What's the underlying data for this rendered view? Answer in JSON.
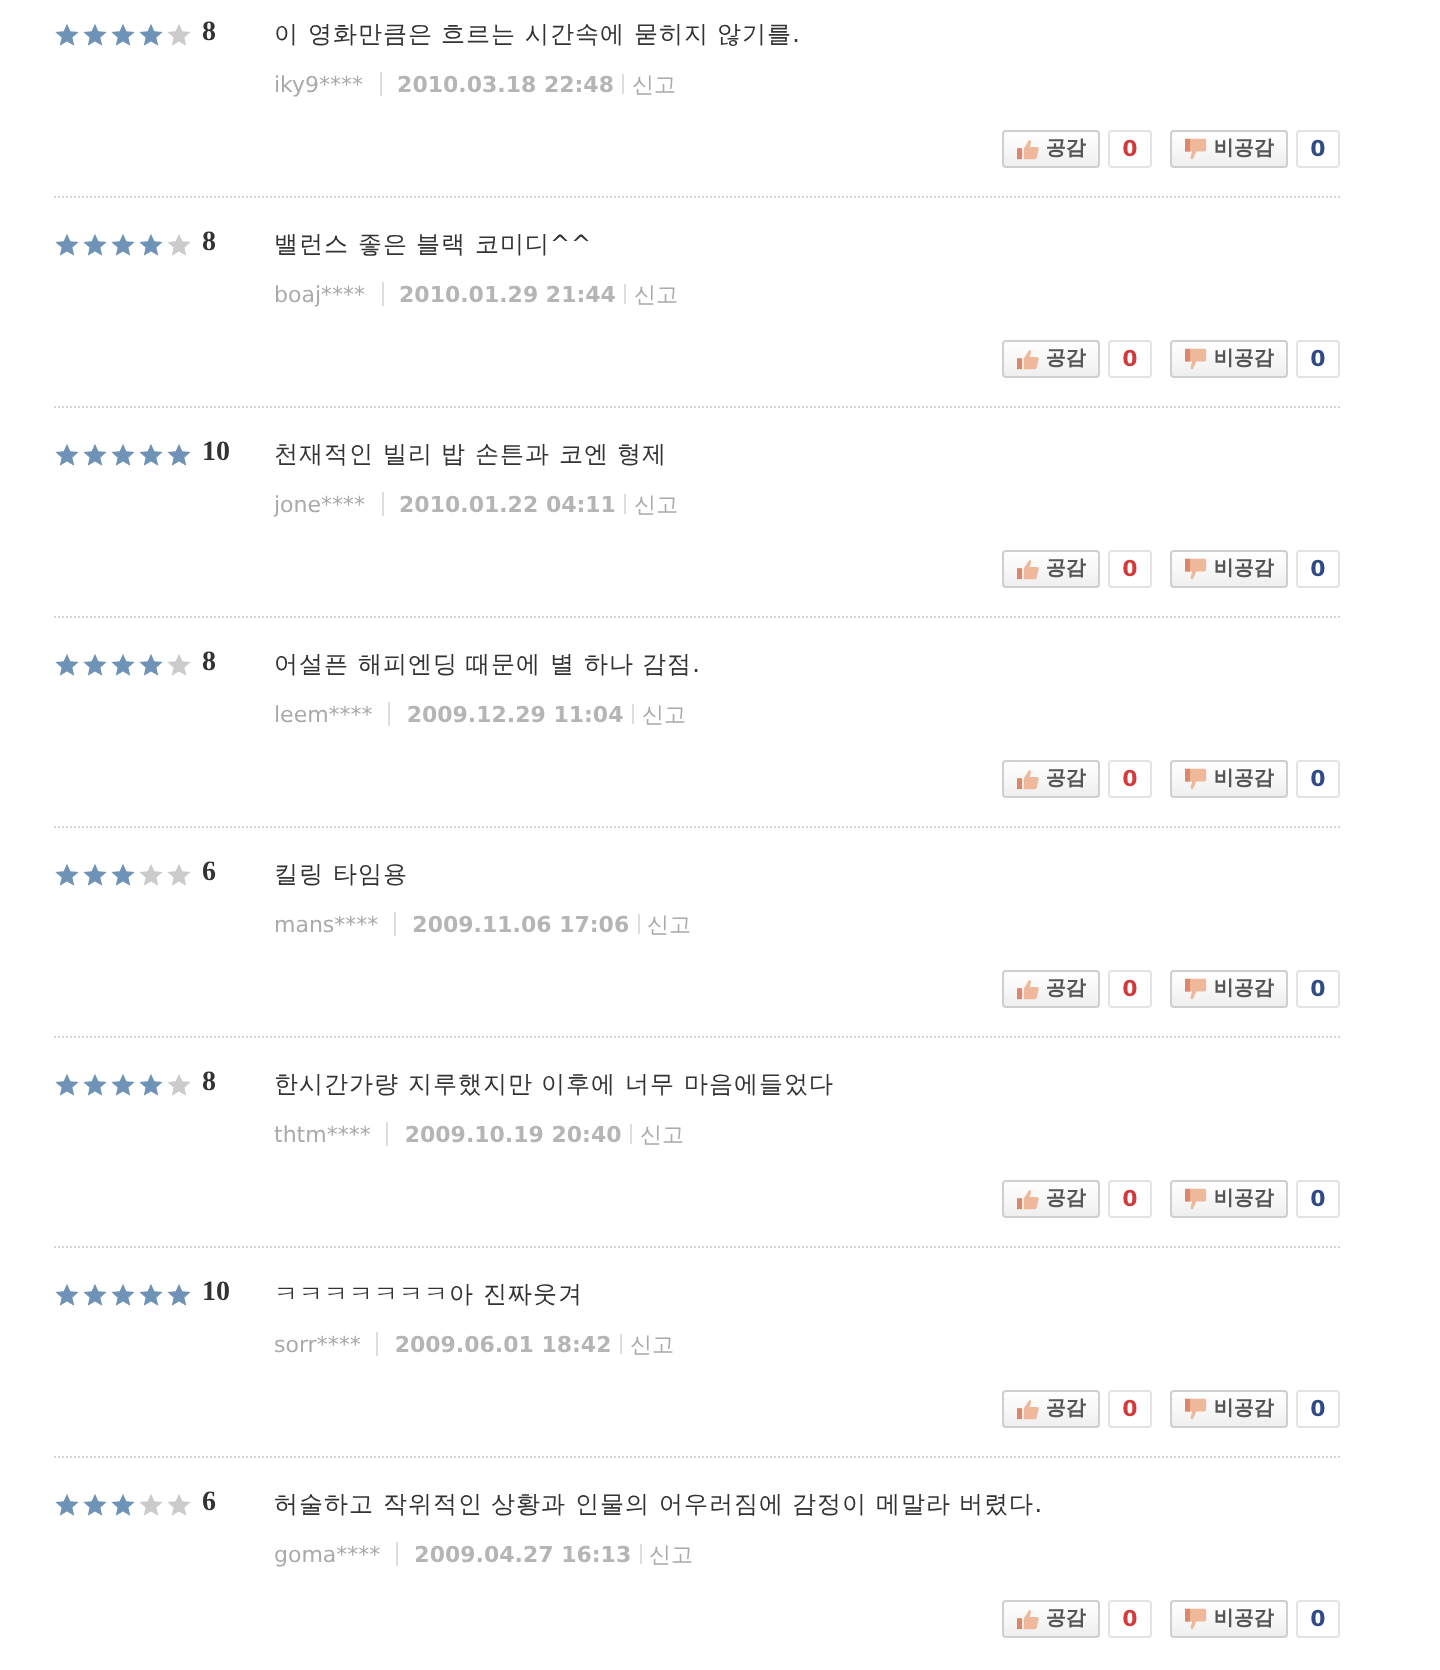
{
  "reviews": [
    {
      "stars": 4,
      "score": "8",
      "comment": "이 영화만큼은 흐르는 시간속에 묻히지 않기를.",
      "user": "iky9****",
      "date": "2010.03.18 22:48",
      "report": "신고",
      "like": {
        "label": "공감",
        "count": "0"
      },
      "dislike": {
        "label": "비공감",
        "count": "0"
      }
    },
    {
      "stars": 4,
      "score": "8",
      "comment": "밸런스 좋은 블랙 코미디^^",
      "user": "boaj****",
      "date": "2010.01.29 21:44",
      "report": "신고",
      "like": {
        "label": "공감",
        "count": "0"
      },
      "dislike": {
        "label": "비공감",
        "count": "0"
      }
    },
    {
      "stars": 5,
      "score": "10",
      "comment": "천재적인 빌리 밥 손튼과 코엔 형제",
      "user": "jone****",
      "date": "2010.01.22 04:11",
      "report": "신고",
      "like": {
        "label": "공감",
        "count": "0"
      },
      "dislike": {
        "label": "비공감",
        "count": "0"
      }
    },
    {
      "stars": 4,
      "score": "8",
      "comment": "어설픈 해피엔딩 때문에 별 하나 감점.",
      "user": "leem****",
      "date": "2009.12.29 11:04",
      "report": "신고",
      "like": {
        "label": "공감",
        "count": "0"
      },
      "dislike": {
        "label": "비공감",
        "count": "0"
      }
    },
    {
      "stars": 3,
      "score": "6",
      "comment": "킬링 타임용",
      "user": "mans****",
      "date": "2009.11.06 17:06",
      "report": "신고",
      "like": {
        "label": "공감",
        "count": "0"
      },
      "dislike": {
        "label": "비공감",
        "count": "0"
      }
    },
    {
      "stars": 4,
      "score": "8",
      "comment": "한시간가량 지루했지만 이후에 너무 마음에들었다",
      "user": "thtm****",
      "date": "2009.10.19 20:40",
      "report": "신고",
      "like": {
        "label": "공감",
        "count": "0"
      },
      "dislike": {
        "label": "비공감",
        "count": "0"
      }
    },
    {
      "stars": 5,
      "score": "10",
      "comment": "ㅋㅋㅋㅋㅋㅋㅋ아 진짜웃겨",
      "user": "sorr****",
      "date": "2009.06.01 18:42",
      "report": "신고",
      "like": {
        "label": "공감",
        "count": "0"
      },
      "dislike": {
        "label": "비공감",
        "count": "0"
      }
    },
    {
      "stars": 3,
      "score": "6",
      "comment": "허술하고 작위적인 상황과 인물의 어우러짐에 감정이 메말라 버렸다.",
      "user": "goma****",
      "date": "2009.04.27 16:13",
      "report": "신고",
      "like": {
        "label": "공감",
        "count": "0"
      },
      "dislike": {
        "label": "비공감",
        "count": "0"
      }
    }
  ]
}
